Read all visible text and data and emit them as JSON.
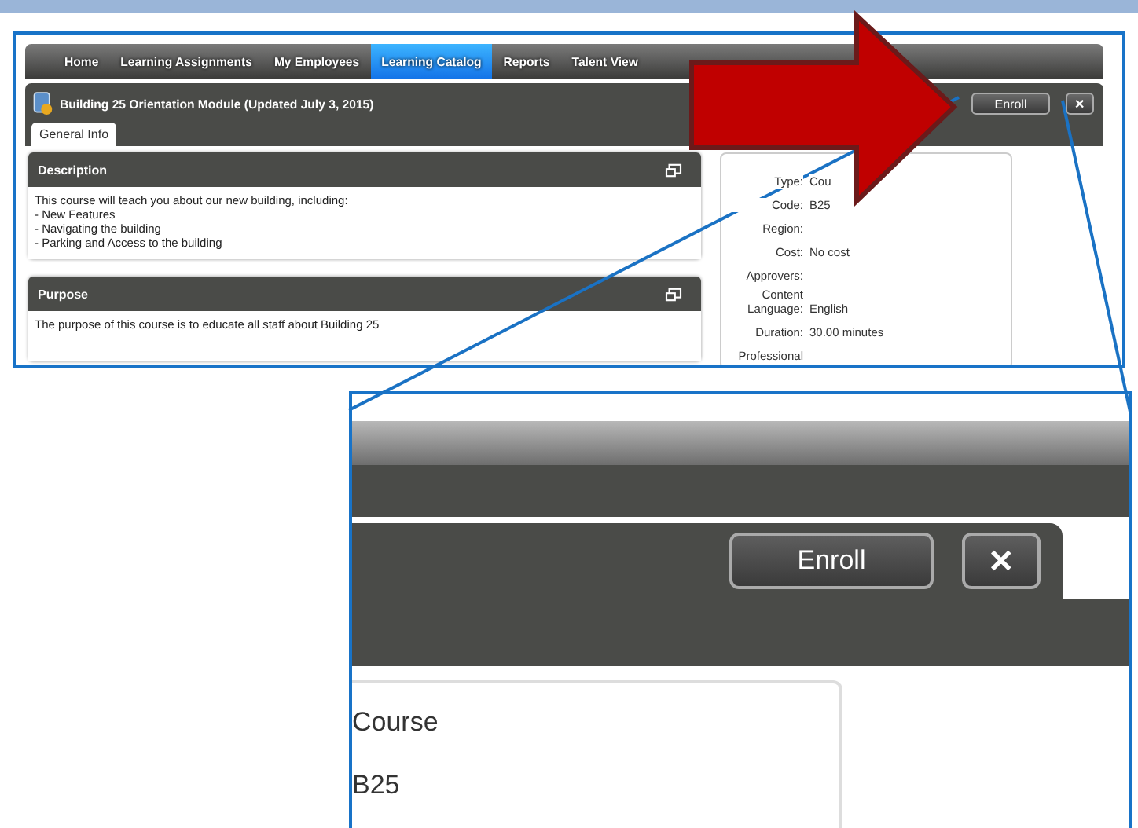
{
  "screenshot": {
    "nav_items": [
      {
        "label": "Home",
        "selected": false
      },
      {
        "label": "Learning Assignments",
        "selected": false
      },
      {
        "label": "My Employees",
        "selected": false
      },
      {
        "label": "Learning Catalog",
        "selected": true
      },
      {
        "label": "Reports",
        "selected": false
      },
      {
        "label": "Talent View",
        "selected": false
      }
    ],
    "page_title": "Building 25 Orientation Module (Updated July 3, 2015)",
    "buttons": [
      {
        "kind": "enroll",
        "label": "Enroll"
      },
      {
        "kind": "close",
        "label": "✕"
      }
    ],
    "tabs": [
      {
        "label": "General Info",
        "selected": true
      }
    ],
    "panels": [
      {
        "title": "Description",
        "lines": [
          "This course will teach you about our new building, including:",
          "- New Features",
          "- Navigating the building",
          "- Parking and Access to the building"
        ]
      },
      {
        "title": "Purpose",
        "lines": [
          "The purpose of this course is to educate all staff about Building 25"
        ]
      }
    ],
    "details": [
      {
        "label": "Type:",
        "value": "Cou"
      },
      {
        "label": "Code:",
        "value": "B25"
      },
      {
        "label": "Region:"
      },
      {
        "label": "Cost:",
        "value": "No cost"
      },
      {
        "label": "Approvers:"
      },
      {
        "label": "Content Language:",
        "value": "English"
      },
      {
        "label": "Duration:",
        "value": "30.00 minutes"
      },
      {
        "label": "Professional"
      }
    ]
  },
  "zoom_callout": {
    "buttons": [
      {
        "kind": "enroll",
        "label": "Enroll"
      },
      {
        "kind": "close",
        "label": "✕"
      }
    ],
    "detail_values": [
      "Course",
      "B25"
    ]
  }
}
